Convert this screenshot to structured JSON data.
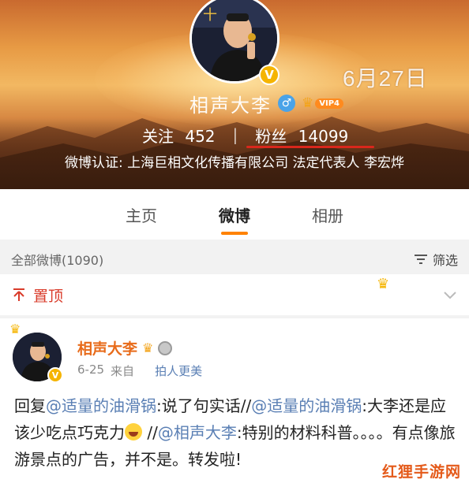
{
  "header": {
    "date_stamp": "6月27日",
    "profile_name": "相声大李",
    "vip_label": "VIP4",
    "follow_label": "关注",
    "follow_count": "452",
    "fans_label": "粉丝",
    "fans_count": "14099",
    "verify_text": "微博认证: 上海巨相文化传播有限公司 法定代表人 李宏烨"
  },
  "tabs": [
    {
      "label": "主页",
      "active": false
    },
    {
      "label": "微博",
      "active": true
    },
    {
      "label": "相册",
      "active": false
    }
  ],
  "filter_bar": {
    "all_weibo": "全部微博(1090)",
    "filter_label": "筛选"
  },
  "pinned": {
    "label": "置顶"
  },
  "post": {
    "author": "相声大李",
    "time": "6-25",
    "source_prefix": "来自",
    "device": "拍人更美",
    "body_reply": "回复",
    "mention_1": "@适量的油滑锅",
    "body_part_1": ":说了句实话//",
    "mention_2": "@适量的油滑锅",
    "body_part_2": ":大李还是应该少吃点巧克力",
    "body_part_3": " //",
    "mention_3": "@相声大李",
    "body_part_4": ":特别的材料科普。。。。有点像旅游景点的广告，并不是。转发啦!"
  },
  "watermark": "红狸手游网",
  "colors": {
    "accent_orange": "#ff8200",
    "fans_underline": "#d9271c",
    "mention_blue": "#5a7fb4",
    "pin_red": "#d93b2a",
    "author_orange": "#e86b1a"
  },
  "icons": [
    "male-icon",
    "crown-icon",
    "verified-v-icon",
    "filter-icon",
    "pin-icon",
    "chevron-down-icon",
    "medal-icon",
    "laugh-emoji-icon"
  ]
}
